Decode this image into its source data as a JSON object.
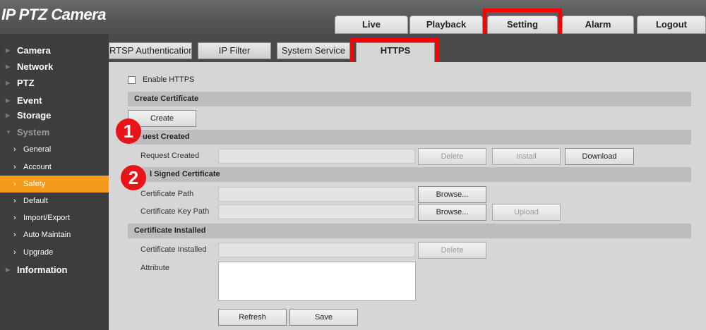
{
  "header": {
    "title": "IP PTZ Camera"
  },
  "top_tabs": [
    {
      "label": "Live"
    },
    {
      "label": "Playback"
    },
    {
      "label": "Setting"
    },
    {
      "label": "Alarm"
    },
    {
      "label": "Logout"
    }
  ],
  "sidebar": {
    "items": [
      {
        "label": "Camera"
      },
      {
        "label": "Network"
      },
      {
        "label": "PTZ"
      },
      {
        "label": "Event"
      },
      {
        "label": "Storage"
      },
      {
        "label": "System"
      }
    ],
    "system_sub": [
      {
        "label": "General"
      },
      {
        "label": "Account"
      },
      {
        "label": "Safety"
      },
      {
        "label": "Default"
      },
      {
        "label": "Import/Export"
      },
      {
        "label": "Auto Maintain"
      },
      {
        "label": "Upgrade"
      }
    ],
    "information": "Information"
  },
  "sub_tabs": [
    {
      "label": "RTSP Authentication"
    },
    {
      "label": "IP Filter"
    },
    {
      "label": "System Service"
    },
    {
      "label": "HTTPS"
    }
  ],
  "https": {
    "enable_label": "Enable HTTPS",
    "create_section": "Create Certificate",
    "create_btn": "Create",
    "request_section": "uest Created",
    "request_label": "Request Created",
    "delete_btn": "Delete",
    "install_btn": "Install",
    "download_btn": "Download",
    "signed_section": "l Signed Certificate",
    "cert_path_label": "Certificate Path",
    "cert_key_label": "Certificate Key Path",
    "browse_btn": "Browse...",
    "upload_btn": "Upload",
    "installed_section": "Certificate Installed",
    "installed_label": "Certificate Installed",
    "attribute_label": "Attribute",
    "refresh_btn": "Refresh",
    "save_btn": "Save"
  },
  "annotations": [
    {
      "label": "1"
    },
    {
      "label": "2"
    }
  ],
  "colors": {
    "highlight": "#ff0000",
    "active_menu": "#f59b1b",
    "badge": "#e8141a"
  }
}
